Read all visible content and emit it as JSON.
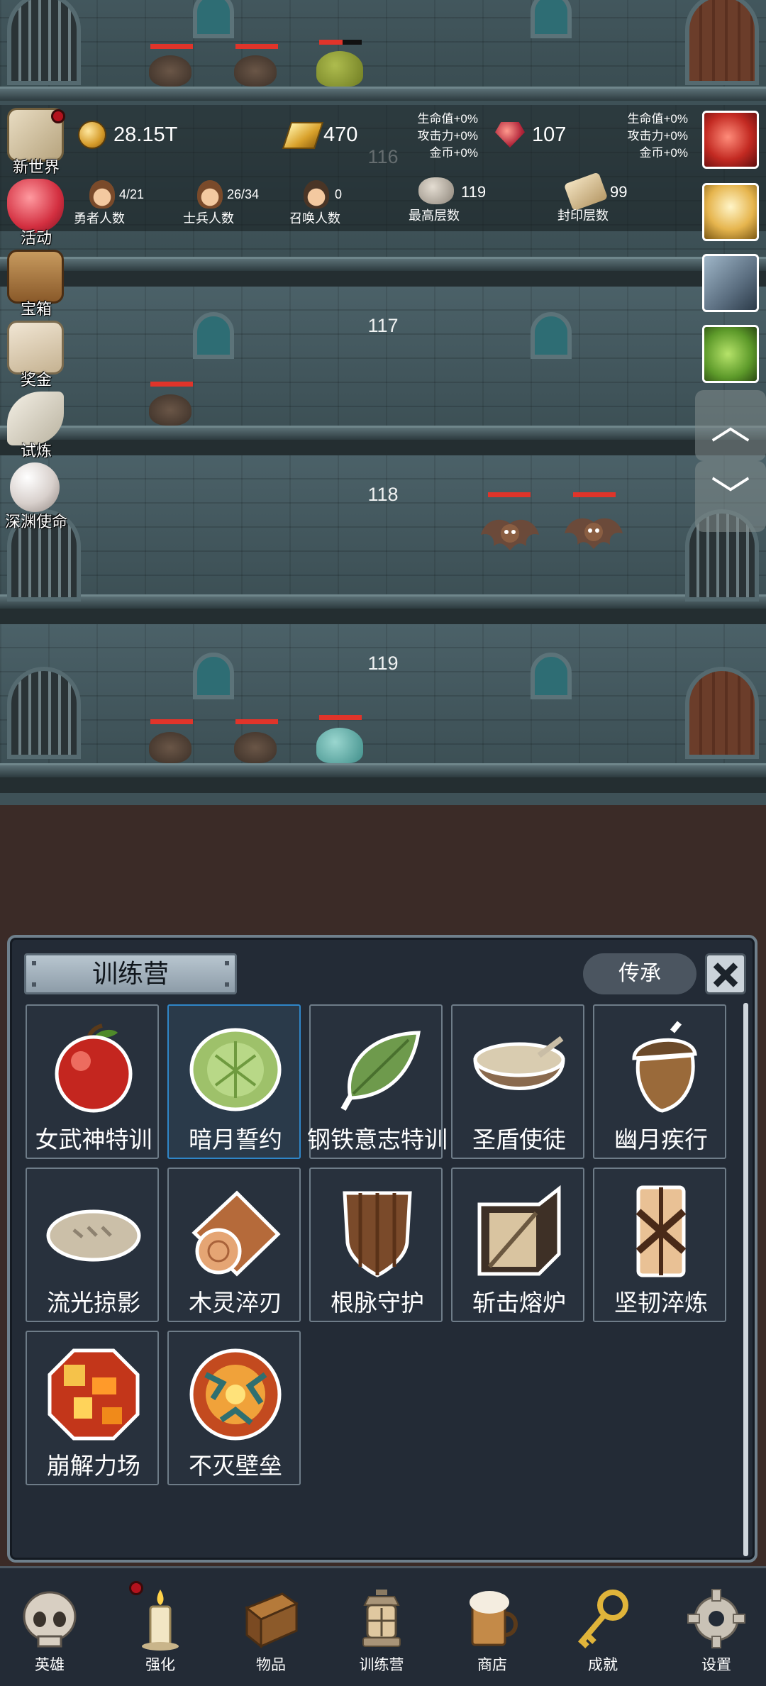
{
  "currency": {
    "gold_coin": "28.15T",
    "gold_bar": "470",
    "ruby": "107"
  },
  "bonuses_left": [
    "生命值+0%",
    "攻击力+0%",
    "金币+0%"
  ],
  "bonuses_right": [
    "生命值+0%",
    "攻击力+0%",
    "金币+0%"
  ],
  "stats": {
    "heroes": {
      "value": "4/21",
      "label": "勇者人数"
    },
    "soldiers": {
      "value": "26/34",
      "label": "士兵人数"
    },
    "summons": {
      "value": "0",
      "label": "召唤人数"
    },
    "max_floor": {
      "value": "119",
      "label": "最高层数"
    },
    "sealed_floor": {
      "value": "99",
      "label": "封印层数"
    }
  },
  "floors": [
    "116",
    "117",
    "118",
    "119"
  ],
  "side_menu": [
    "新世界",
    "活动",
    "宝箱",
    "奖金",
    "试炼",
    "深渊使命"
  ],
  "panel": {
    "title": "训练营",
    "inherit_label": "传承",
    "items": [
      {
        "label": "女武神特训",
        "icon": "apple-icon"
      },
      {
        "label": "暗月誓约",
        "icon": "cabbage-icon"
      },
      {
        "label": "钢铁意志特训",
        "icon": "leaf-icon"
      },
      {
        "label": "圣盾使徒",
        "icon": "bowl-icon"
      },
      {
        "label": "幽月疾行",
        "icon": "acorn-icon"
      },
      {
        "label": "流光掠影",
        "icon": "bread-icon"
      },
      {
        "label": "木灵淬刃",
        "icon": "log-icon"
      },
      {
        "label": "根脉守护",
        "icon": "wooden-shield-icon"
      },
      {
        "label": "斩击熔炉",
        "icon": "block-icon"
      },
      {
        "label": "坚韧淬炼",
        "icon": "tower-shield-icon"
      },
      {
        "label": "崩解力场",
        "icon": "fire-orb-icon"
      },
      {
        "label": "不灭壁垒",
        "icon": "lava-orb-icon"
      }
    ]
  },
  "bottom_nav": [
    "英雄",
    "强化",
    "物品",
    "训练营",
    "商店",
    "成就",
    "设置"
  ]
}
